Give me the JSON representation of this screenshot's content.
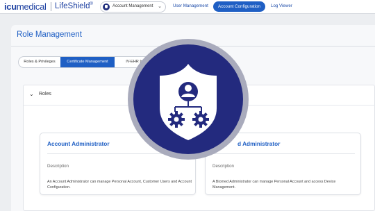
{
  "brand": {
    "logo_prefix": "icu",
    "logo_suffix": "medical",
    "product": "LifeShield",
    "product_mark": "®"
  },
  "header": {
    "account_select": {
      "value": "Account Management"
    },
    "nav": {
      "user_management": "User Management",
      "account_configuration": "Account Configuration",
      "log_viewer": "Log Viewer"
    },
    "active_nav": "account_configuration",
    "accent_color": "#1f5fc4"
  },
  "page": {
    "title": "Role Management",
    "tabs": [
      {
        "label": "Roles & Privileges",
        "active": false
      },
      {
        "label": "Certificate Management",
        "active": true
      },
      {
        "label": "IV-EHR Interop",
        "active": false
      }
    ],
    "roles_section": {
      "label": "Roles",
      "expanded": true,
      "cards": [
        {
          "title": "Account Administrator",
          "description_label": "Description",
          "description": "An Account Administrator can manage Personal Account, Customer Users and Account Configuration."
        },
        {
          "title": "d Administrator",
          "description_label": "Description",
          "description": "A Biomed Administrator can manage Personal Account and access Device Management."
        }
      ]
    }
  },
  "overlay": {
    "icon": "shield-user-gears-icon",
    "color": "#232a7e"
  }
}
